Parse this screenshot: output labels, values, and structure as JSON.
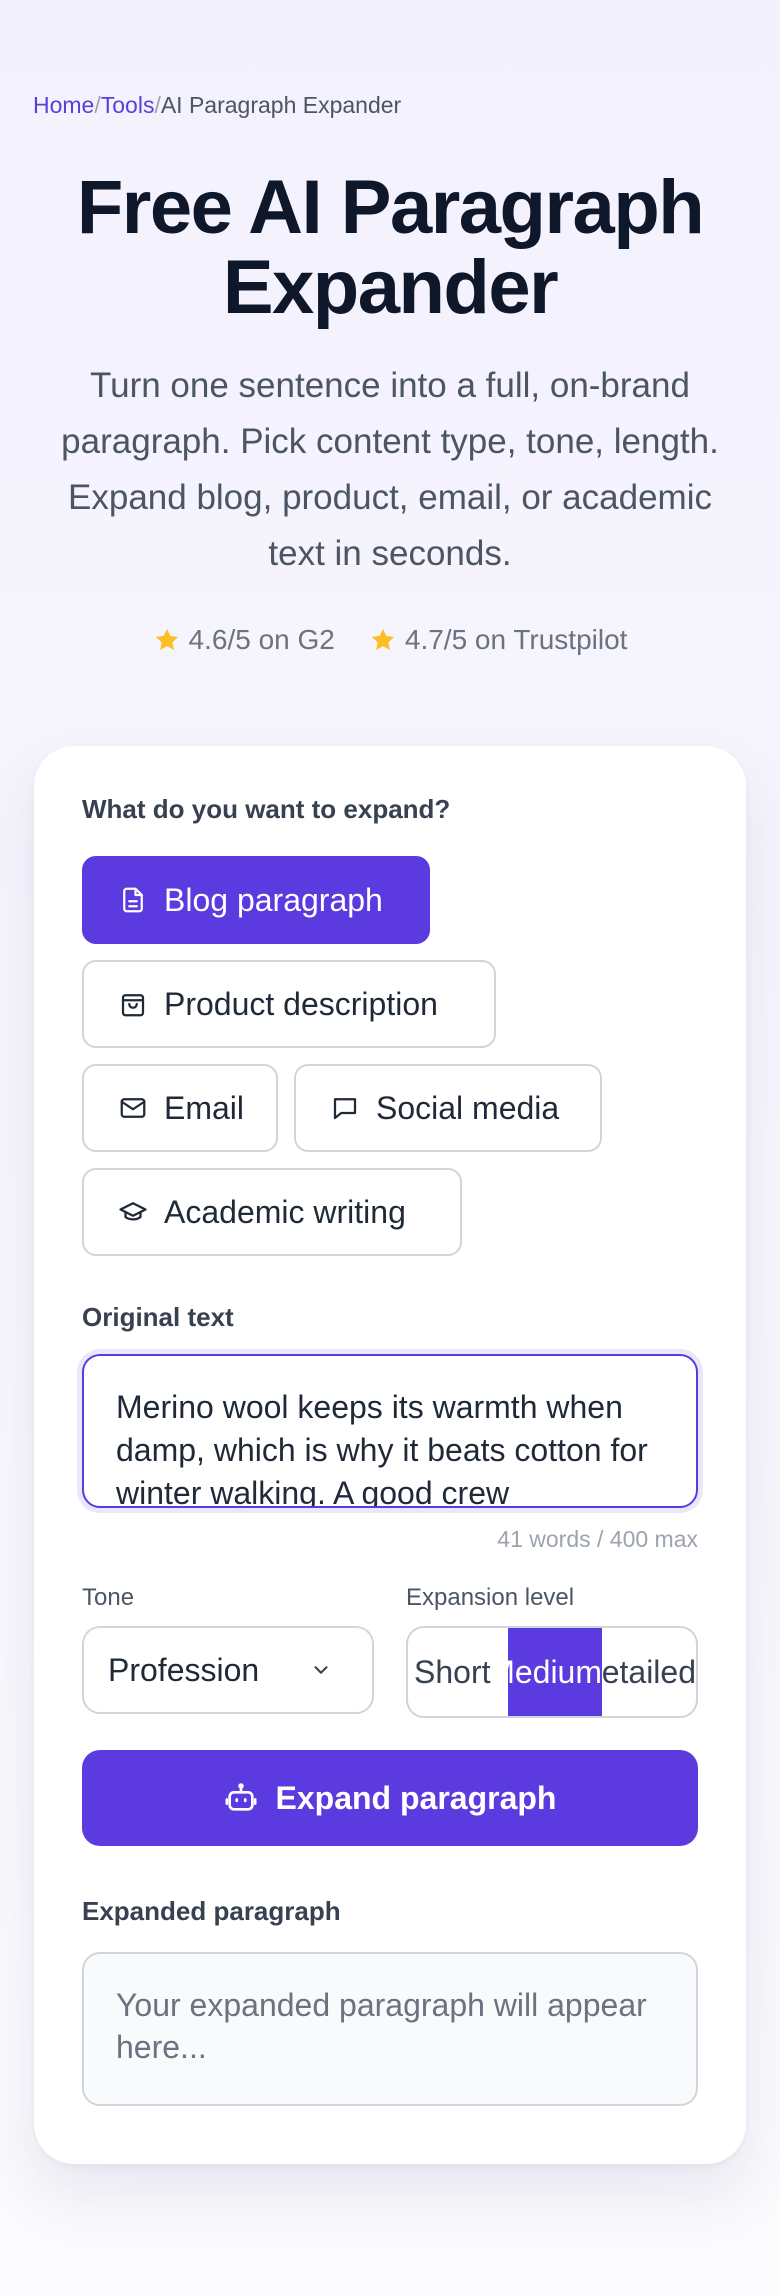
{
  "breadcrumb": {
    "home": "Home",
    "tools": "Tools",
    "current": "AI Paragraph Expander",
    "separator": "/"
  },
  "hero": {
    "title": "Free AI Paragraph Expander",
    "subtitle": "Turn one sentence into a full, on-brand paragraph. Pick content type, tone, length. Expand blog, product, email, or academic text in seconds."
  },
  "ratings": [
    {
      "icon": "star-icon",
      "text": "4.6/5 on G2"
    },
    {
      "icon": "star-icon",
      "text": "4.7/5 on Trustpilot"
    }
  ],
  "form": {
    "content_type_label": "What do you want to expand?",
    "content_types": [
      {
        "label": "Blog paragraph",
        "icon": "document-icon",
        "selected": true
      },
      {
        "label": "Product description",
        "icon": "shopping-bag-icon",
        "selected": false
      },
      {
        "label": "Email",
        "icon": "mail-icon",
        "selected": false
      },
      {
        "label": "Social media",
        "icon": "chat-bubble-icon",
        "selected": false
      },
      {
        "label": "Academic writing",
        "icon": "graduation-cap-icon",
        "selected": false
      }
    ],
    "original_label": "Original text",
    "original_value": "Merino wool keeps its warmth when damp, which is why it beats cotton for winter walking. A good crew",
    "word_counter": "41 words / 400 max",
    "tone_label": "Tone",
    "tone_value": "Profession",
    "expansion_label": "Expansion level",
    "expansion_options": [
      "Short",
      "Medium",
      "Detailed"
    ],
    "expansion_selected": "Medium",
    "expand_button": "Expand paragraph",
    "output_label": "Expanded paragraph",
    "output_placeholder": "Your expanded paragraph will appear here..."
  },
  "colors": {
    "accent": "#5b3ae0",
    "star": "#fbbf24",
    "link": "#5b3fd9"
  }
}
